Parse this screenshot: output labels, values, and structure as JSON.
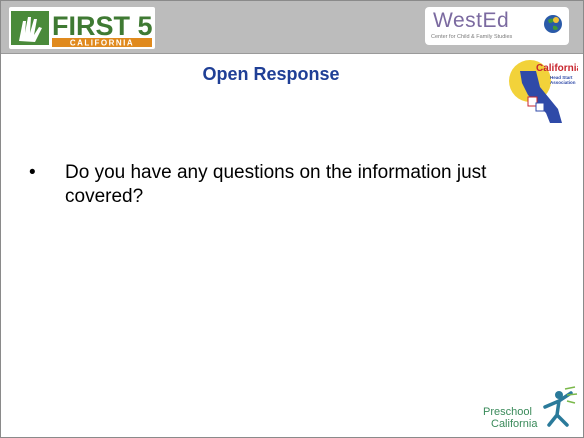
{
  "header": {
    "first5_logo": {
      "main": "FIRST 5",
      "sub": "CALIFORNIA",
      "icon": "hand-icon"
    },
    "wested_logo": {
      "main": "WestEd",
      "sub": "Center for Child & Family Studies",
      "icon": "globe-icon"
    }
  },
  "slide": {
    "title": "Open Response",
    "bullets": [
      {
        "marker": "•",
        "text": "Do you have any questions on the information just covered?"
      }
    ]
  },
  "badges": {
    "hsa": {
      "line1": "California",
      "line2": "Head Start",
      "line3": "Association"
    },
    "preschool": {
      "line1": "Preschool",
      "line2": "California"
    }
  },
  "colors": {
    "title": "#1f3f96",
    "header_band": "#bcbcbc",
    "first5_green": "#4a8a3a",
    "wested_purple": "#7b6aa0",
    "hsa_blue": "#2f4aa8",
    "hsa_yellow": "#f2d23a"
  }
}
